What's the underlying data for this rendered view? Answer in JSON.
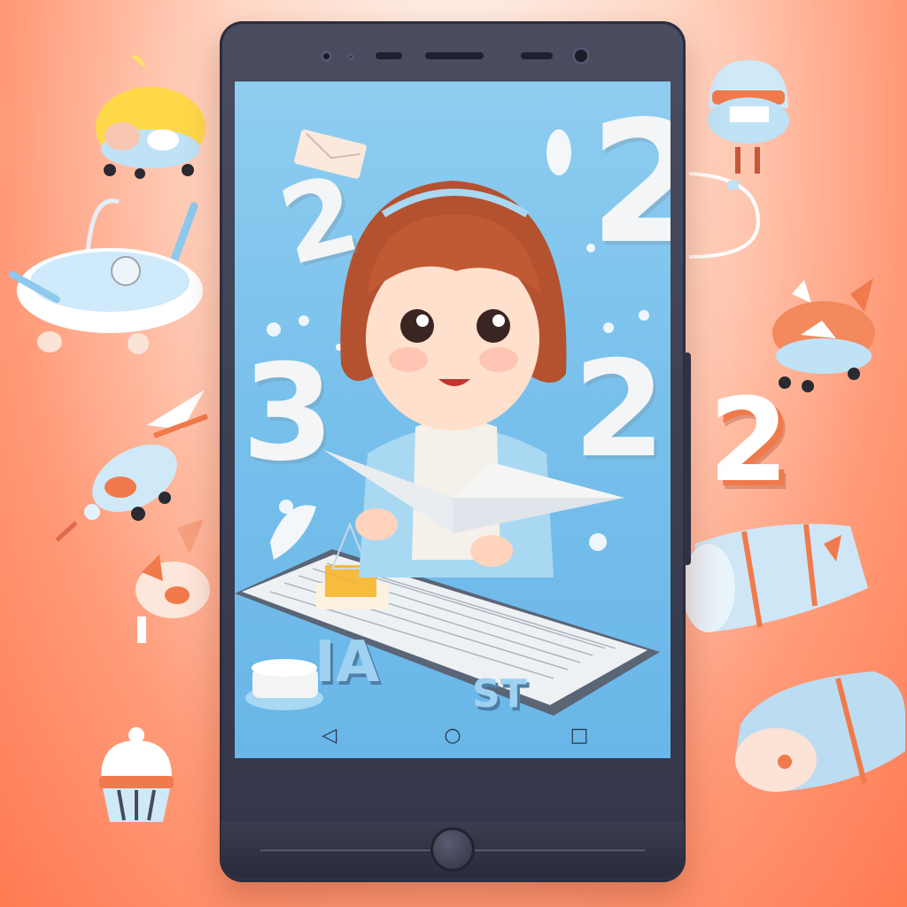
{
  "scene": {
    "description_colors": {
      "background": "#ff8a64",
      "phone_body": "#3e4054",
      "screen": "#7bc3ec",
      "accent_blue": "#a9d8f3"
    }
  },
  "screen_numbers": [
    "2",
    "3",
    "2",
    "2"
  ],
  "screen_letters": {
    "left": "IA",
    "right": "ST"
  },
  "outside_number": "2",
  "navbar": {
    "back": "◁",
    "home": "○",
    "recents": "□"
  },
  "icons": [
    "back-icon",
    "home-icon",
    "recents-icon",
    "camera-icon",
    "speaker-icon"
  ]
}
